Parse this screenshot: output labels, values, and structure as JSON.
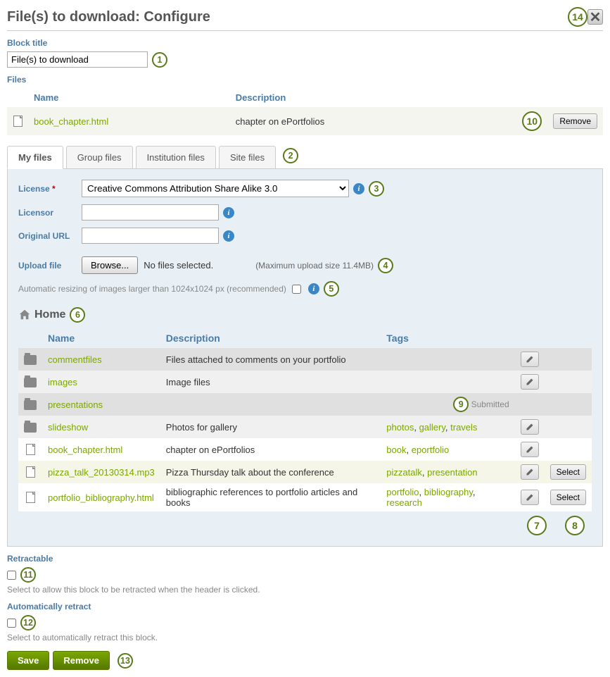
{
  "dialog_title": "File(s) to download: Configure",
  "close_label": "✕",
  "block_title": {
    "label": "Block title",
    "value": "File(s) to download"
  },
  "files": {
    "label": "Files",
    "columns": {
      "name": "Name",
      "description": "Description"
    },
    "row": {
      "name": "book_chapter.html",
      "desc": "chapter on ePortfolios",
      "remove_label": "Remove"
    }
  },
  "tabs": {
    "my": "My files",
    "group": "Group files",
    "inst": "Institution files",
    "site": "Site files"
  },
  "config": {
    "license": {
      "label": "License",
      "required": "*",
      "value": "Creative Commons Attribution Share Alike 3.0"
    },
    "licensor": {
      "label": "Licensor",
      "value": ""
    },
    "url": {
      "label": "Original URL",
      "value": ""
    },
    "upload": {
      "label": "Upload file",
      "browse": "Browse...",
      "none": "No files selected.",
      "max": "(Maximum upload size 11.4MB)"
    },
    "resize": "Automatic resizing of images larger than 1024x1024 px (recommended)"
  },
  "breadcrumb": {
    "home": "Home"
  },
  "list": {
    "columns": {
      "name": "Name",
      "desc": "Description",
      "tags": "Tags"
    },
    "rows": [
      {
        "type": "folder",
        "name": "commentfiles",
        "desc": "Files attached to comments on your portfolio",
        "tags": [],
        "submitted": false,
        "select": false
      },
      {
        "type": "folder",
        "name": "images",
        "desc": "Image files",
        "tags": [],
        "submitted": false,
        "select": false
      },
      {
        "type": "folder",
        "name": "presentations",
        "desc": "",
        "tags": [],
        "submitted": true,
        "select": false
      },
      {
        "type": "folder",
        "name": "slideshow",
        "desc": "Photos for gallery",
        "tags": [
          "photos",
          "gallery",
          "travels"
        ],
        "submitted": false,
        "select": false
      },
      {
        "type": "file",
        "name": "book_chapter.html",
        "desc": "chapter on ePortfolios",
        "tags": [
          "book",
          "eportfolio"
        ],
        "submitted": false,
        "select": false
      },
      {
        "type": "file",
        "name": "pizza_talk_20130314.mp3",
        "desc": "Pizza Thursday talk about the conference",
        "tags": [
          "pizzatalk",
          "presentation"
        ],
        "submitted": false,
        "select": true
      },
      {
        "type": "file",
        "name": "portfolio_bibliography.html",
        "desc": "bibliographic references to portfolio articles and books",
        "tags": [
          "portfolio",
          "bibliography",
          "research"
        ],
        "submitted": false,
        "select": true
      }
    ],
    "submitted_label": "Submitted",
    "select_label": "Select"
  },
  "retractable": {
    "label": "Retractable",
    "hint": "Select to allow this block to be retracted when the header is clicked."
  },
  "auto_retract": {
    "label": "Automatically retract",
    "hint": "Select to automatically retract this block."
  },
  "save_label": "Save",
  "removeblk_label": "Remove",
  "callouts": {
    "c1": "1",
    "c2": "2",
    "c3": "3",
    "c4": "4",
    "c5": "5",
    "c6": "6",
    "c7": "7",
    "c8": "8",
    "c9": "9",
    "c10": "10",
    "c11": "11",
    "c12": "12",
    "c13": "13",
    "c14": "14"
  }
}
